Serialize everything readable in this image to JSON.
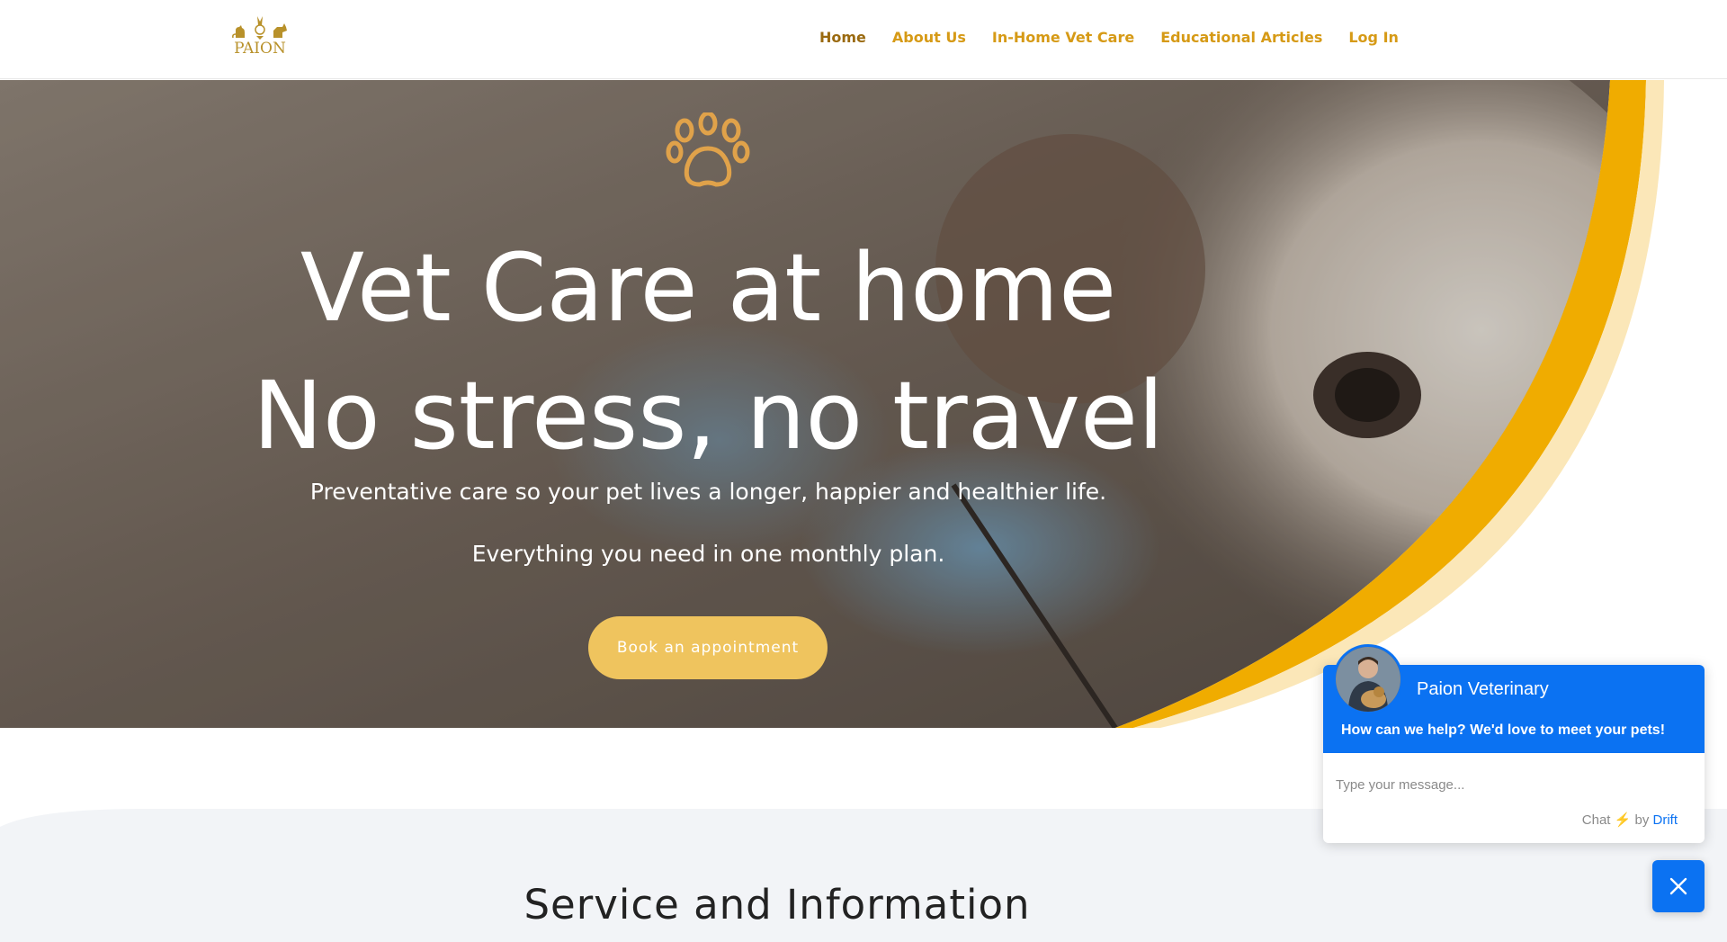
{
  "header": {
    "logo_text": "PAION",
    "nav": [
      {
        "label": "Home"
      },
      {
        "label": "About Us"
      },
      {
        "label": "In-Home Vet Care"
      },
      {
        "label": "Educational Articles"
      },
      {
        "label": "Log In"
      }
    ]
  },
  "hero": {
    "title_line1": "Vet Care at home",
    "title_line2": "No stress, no travel",
    "subtitle1": "Preventative care so your pet lives a longer, happier and healthier life.",
    "subtitle2": "Everything you need in one monthly plan.",
    "cta_label": "Book an appointment",
    "icon": "paw-icon"
  },
  "section": {
    "title": "Service and Information"
  },
  "chat": {
    "name": "Paion Veterinary",
    "message": "How can we help? We'd love to meet your pets!",
    "input_placeholder": "Type your message...",
    "credit_prefix": "Chat",
    "credit_by": "by",
    "credit_brand": "Drift",
    "close_icon": "close-icon"
  },
  "colors": {
    "brand_gold": "#d69a16",
    "button_yellow": "#efc45e",
    "arc_orange": "#f0ac00",
    "chat_blue": "#0b72f2"
  }
}
